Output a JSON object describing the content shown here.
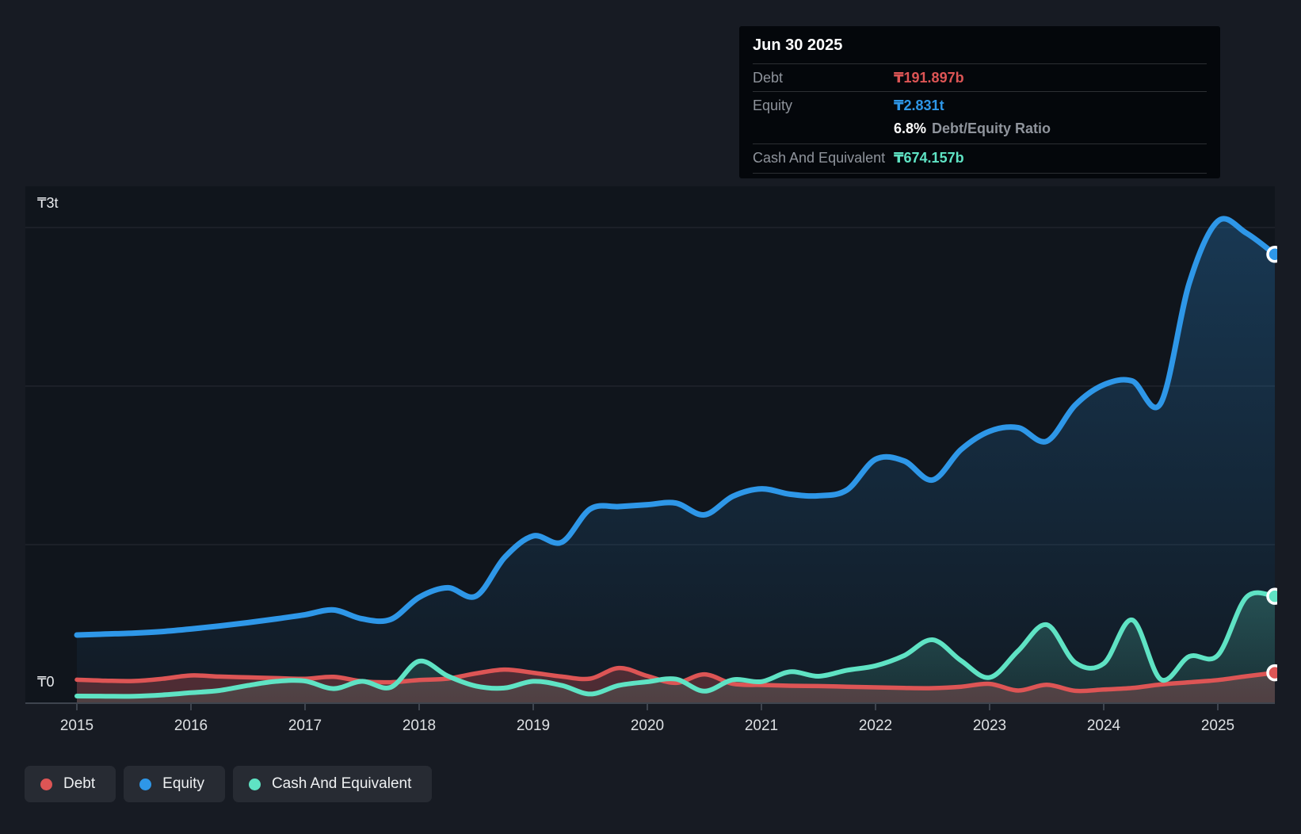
{
  "tooltip": {
    "date": "Jun 30 2025",
    "debt_label": "Debt",
    "debt_value": "₸191.897b",
    "equity_label": "Equity",
    "equity_value": "₸2.831t",
    "ratio_value": "6.8%",
    "ratio_label": "Debt/Equity Ratio",
    "cash_label": "Cash And Equivalent",
    "cash_value": "₸674.157b"
  },
  "legend": {
    "items": [
      {
        "label": "Debt",
        "color": "#dd5555"
      },
      {
        "label": "Equity",
        "color": "#2e97e8"
      },
      {
        "label": "Cash And Equivalent",
        "color": "#5fe3c4"
      }
    ]
  },
  "chart_data": {
    "type": "area",
    "title": "",
    "x_start": 2015,
    "x_step": 0.25,
    "x_ticks": [
      2015,
      2016,
      2017,
      2018,
      2019,
      2020,
      2021,
      2022,
      2023,
      2024,
      2025
    ],
    "y_axis": {
      "max_label": "₸3t",
      "zero_label": "₸0",
      "unit": "₸ billions",
      "ylim": [
        0,
        3000
      ],
      "gridlines_b": [
        1000,
        2000,
        3000
      ]
    },
    "legend_position": "bottom-left",
    "series": [
      {
        "name": "Debt",
        "color": "#dd5555",
        "last_point": {
          "date": "Jun 30 2025",
          "value_b": 191.897
        },
        "values": [
          148,
          142,
          140,
          154,
          175,
          168,
          163,
          158,
          154,
          166,
          138,
          132,
          146,
          155,
          188,
          212,
          192,
          168,
          155,
          222,
          172,
          128,
          182,
          122,
          115,
          110,
          108,
          104,
          100,
          96,
          95,
          104,
          122,
          80,
          116,
          78,
          86,
          96,
          118,
          132,
          146,
          170,
          191.897
        ]
      },
      {
        "name": "Equity",
        "color": "#2e97e8",
        "last_point": {
          "date": "Jun 30 2025",
          "value_b": 2831
        },
        "values": [
          430,
          436,
          442,
          452,
          468,
          487,
          508,
          532,
          558,
          588,
          532,
          528,
          668,
          728,
          676,
          920,
          1055,
          1015,
          1225,
          1240,
          1252,
          1262,
          1188,
          1305,
          1352,
          1318,
          1308,
          1345,
          1538,
          1528,
          1408,
          1600,
          1715,
          1738,
          1652,
          1880,
          2008,
          2032,
          1892,
          2650,
          3040,
          2965,
          2831
        ]
      },
      {
        "name": "Cash And Equivalent",
        "color": "#5fe3c4",
        "last_point": {
          "date": "Jun 30 2025",
          "value_b": 674.157
        },
        "values": [
          45,
          44,
          44,
          52,
          66,
          80,
          112,
          138,
          140,
          92,
          138,
          100,
          265,
          172,
          108,
          96,
          138,
          112,
          58,
          112,
          135,
          152,
          76,
          148,
          136,
          198,
          170,
          208,
          236,
          300,
          400,
          268,
          162,
          330,
          495,
          256,
          250,
          525,
          150,
          295,
          302,
          668,
          674.157
        ]
      }
    ],
    "ratio_annotation": "6.8% Debt/Equity Ratio"
  }
}
